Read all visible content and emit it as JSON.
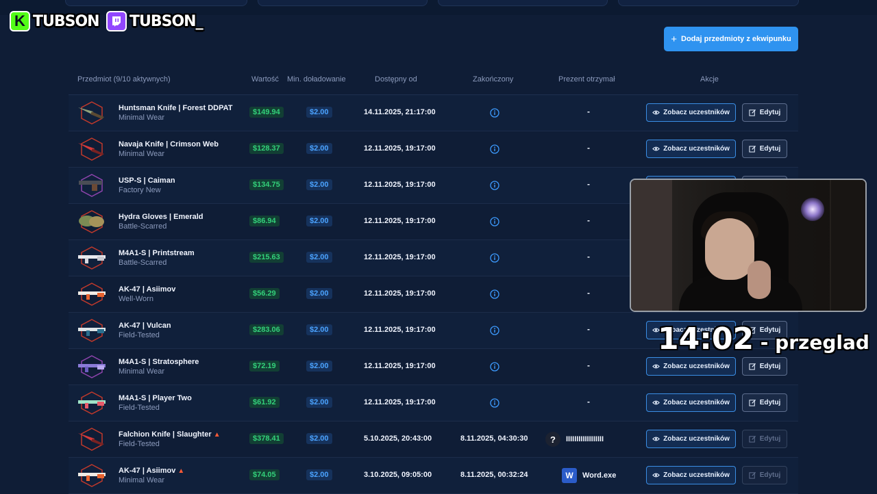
{
  "overlay": {
    "kick_name": "TUBSON",
    "twitch_name": "TUBSON_",
    "timer": "14:02",
    "timer_suffix": " - przeglad"
  },
  "toolbar": {
    "add_label": "Dodaj przedmioty z ekwipunku",
    "add_icon": "plus-icon"
  },
  "table": {
    "headers": {
      "item": "Przedmiot (9/10 aktywnych)",
      "value": "Wartość",
      "min_topup": "Min. doładowanie",
      "available_from": "Dostępny od",
      "ended": "Zakończony",
      "gift_received": "Prezent otrzymał",
      "actions": "Akcje"
    },
    "view_label": "Zobacz uczestników",
    "edit_label": "Edytuj",
    "rows": [
      {
        "name": "Huntsman Knife | Forest DDPAT",
        "wear": "Minimal Wear",
        "value": "$149.94",
        "min": "$2.00",
        "from": "14.11.2025, 21:17:00",
        "ended": "",
        "gift": "-",
        "flame": false,
        "rarity": "#c0392b",
        "skin": "knife-green",
        "edit_disabled": false
      },
      {
        "name": "Navaja Knife | Crimson Web",
        "wear": "Minimal Wear",
        "value": "$128.37",
        "min": "$2.00",
        "from": "12.11.2025, 19:17:00",
        "ended": "",
        "gift": "-",
        "flame": false,
        "rarity": "#c0392b",
        "skin": "knife-red",
        "edit_disabled": false
      },
      {
        "name": "USP-S | Caiman",
        "wear": "Factory New",
        "value": "$134.75",
        "min": "$2.00",
        "from": "12.11.2025, 19:17:00",
        "ended": "",
        "gift": "-",
        "flame": false,
        "rarity": "#8e44ad",
        "skin": "pistol",
        "edit_disabled": false
      },
      {
        "name": "Hydra Gloves | Emerald",
        "wear": "Battle-Scarred",
        "value": "$86.94",
        "min": "$2.00",
        "from": "12.11.2025, 19:17:00",
        "ended": "",
        "gift": "-",
        "flame": false,
        "rarity": "#c0392b",
        "skin": "gloves",
        "edit_disabled": false
      },
      {
        "name": "M4A1-S | Printstream",
        "wear": "Battle-Scarred",
        "value": "$215.63",
        "min": "$2.00",
        "from": "12.11.2025, 19:17:00",
        "ended": "",
        "gift": "-",
        "flame": false,
        "rarity": "#c0392b",
        "skin": "rifle-white",
        "edit_disabled": false
      },
      {
        "name": "AK-47 | Asiimov",
        "wear": "Well-Worn",
        "value": "$56.29",
        "min": "$2.00",
        "from": "12.11.2025, 19:17:00",
        "ended": "",
        "gift": "-",
        "flame": false,
        "rarity": "#c0392b",
        "skin": "rifle-orange",
        "edit_disabled": false
      },
      {
        "name": "AK-47 | Vulcan",
        "wear": "Field-Tested",
        "value": "$283.06",
        "min": "$2.00",
        "from": "12.11.2025, 19:17:00",
        "ended": "",
        "gift": "-",
        "flame": false,
        "rarity": "#c0392b",
        "skin": "rifle-teal",
        "edit_disabled": false
      },
      {
        "name": "M4A1-S | Stratosphere",
        "wear": "Minimal Wear",
        "value": "$72.19",
        "min": "$2.00",
        "from": "12.11.2025, 19:17:00",
        "ended": "",
        "gift": "-",
        "flame": false,
        "rarity": "#8e44ad",
        "skin": "rifle-purple",
        "edit_disabled": false
      },
      {
        "name": "M4A1-S | Player Two",
        "wear": "Field-Tested",
        "value": "$61.92",
        "min": "$2.00",
        "from": "12.11.2025, 19:17:00",
        "ended": "",
        "gift": "-",
        "flame": false,
        "rarity": "#c0392b",
        "skin": "rifle-mint",
        "edit_disabled": false
      },
      {
        "name": "Falchion Knife | Slaughter",
        "wear": "Field-Tested",
        "value": "$378.41",
        "min": "$2.00",
        "from": "5.10.2025, 20:43:00",
        "ended": "8.11.2025, 04:30:30",
        "gift": "IIIIIIIIIIIIIIIIII",
        "gift_icon": "question-avatar",
        "flame": true,
        "rarity": "#c0392b",
        "skin": "knife-red",
        "edit_disabled": true
      },
      {
        "name": "AK-47 | Asiimov",
        "wear": "Minimal Wear",
        "value": "$74.05",
        "min": "$2.00",
        "from": "3.10.2025, 09:05:00",
        "ended": "8.11.2025, 00:32:24",
        "gift": "Word.exe",
        "gift_icon": "word-avatar",
        "flame": true,
        "rarity": "#c0392b",
        "skin": "rifle-orange",
        "edit_disabled": true
      }
    ]
  }
}
